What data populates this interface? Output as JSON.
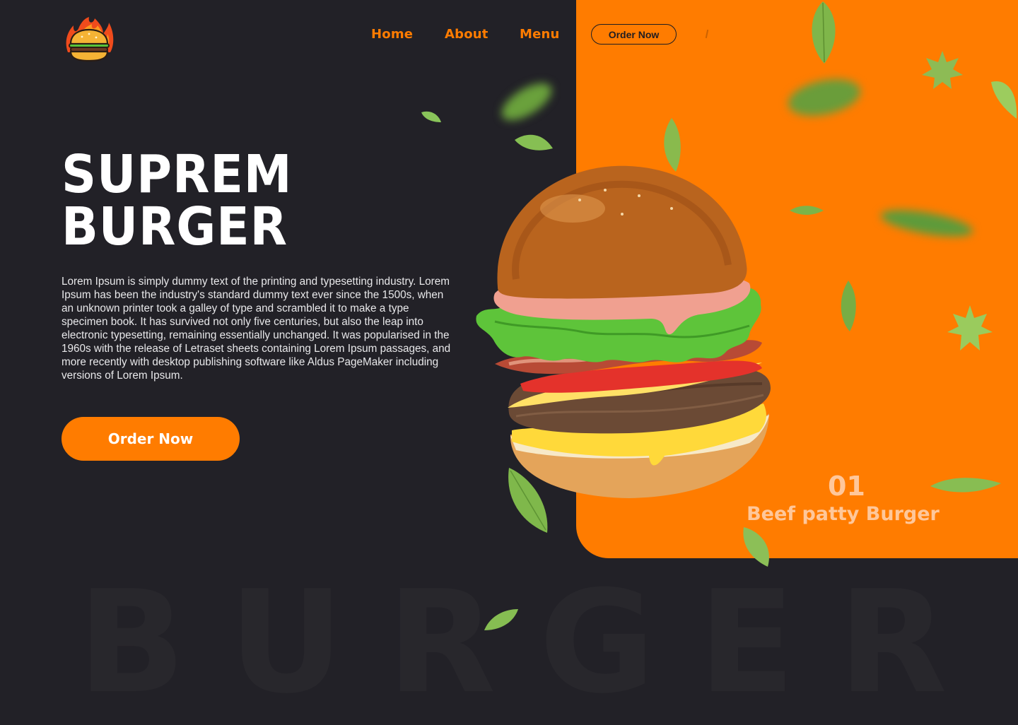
{
  "nav": {
    "links": [
      "Home",
      "About",
      "Menu"
    ],
    "order_button": "Order Now"
  },
  "hero": {
    "title_line1": "SUPREM",
    "title_line2": "BURGER",
    "description": "Lorem Ipsum is simply dummy text of the printing and typesetting industry. Lorem Ipsum has been the industry's standard dummy text ever since the 1500s, when an unknown printer took a galley of type and scrambled it to make a type specimen book. It has survived not only five centuries, but also the leap into electronic typesetting, remaining essentially unchanged. It was popularised in the 1960s with the release of Letraset sheets containing Lorem Ipsum passages, and more recently with desktop publishing software like Aldus PageMaker including versions of Lorem Ipsum.",
    "cta": "Order Now"
  },
  "product": {
    "counter": "01",
    "name": "Beef patty Burger"
  },
  "watermark": [
    "B",
    "U",
    "R",
    "G",
    "E",
    "R"
  ],
  "colors": {
    "background": "#222127",
    "accent": "#ff7c00",
    "text": "#ffffff",
    "product_text": "#ffc79a",
    "watermark": "#28272c"
  },
  "icons": {
    "logo": "flaming-burger-logo-icon"
  }
}
